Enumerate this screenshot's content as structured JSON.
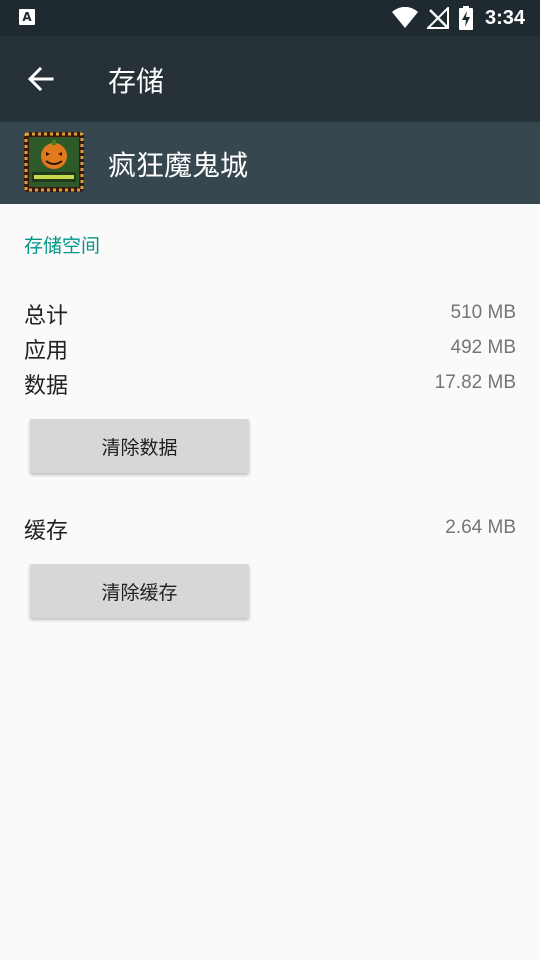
{
  "status_bar": {
    "time": "3:34",
    "notification_icon": "A"
  },
  "toolbar": {
    "title": "存储"
  },
  "app": {
    "name": "疯狂魔鬼城"
  },
  "storage": {
    "section_title": "存储空间",
    "rows": [
      {
        "label": "总计",
        "value": "510 MB"
      },
      {
        "label": "应用",
        "value": "492 MB"
      },
      {
        "label": "数据",
        "value": "17.82 MB"
      }
    ],
    "clear_data_label": "清除数据",
    "cache": {
      "label": "缓存",
      "value": "2.64 MB"
    },
    "clear_cache_label": "清除缓存"
  },
  "colors": {
    "status_bar": "#1f2a30",
    "toolbar": "#263238",
    "app_header": "#37474f",
    "accent": "#009688",
    "background": "#fafafa",
    "button": "#d6d7d7"
  }
}
